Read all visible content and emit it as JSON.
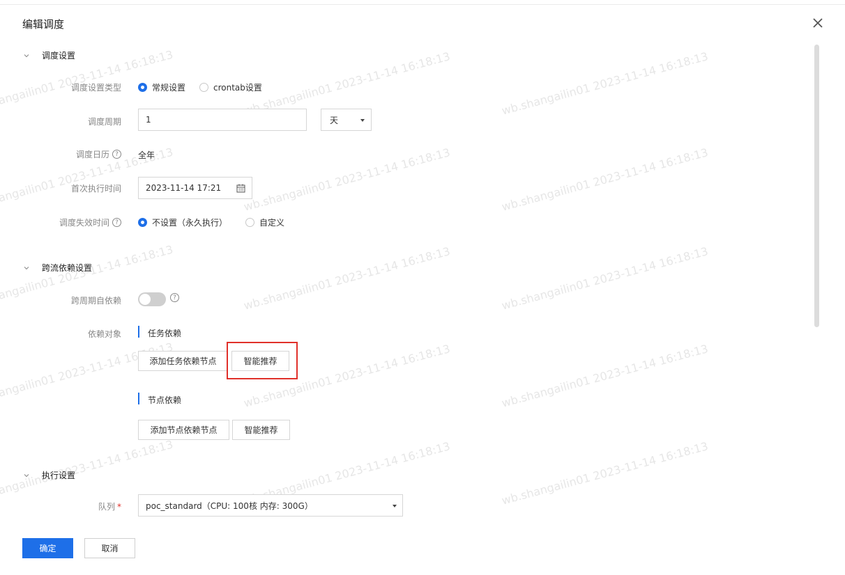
{
  "dialog": {
    "title": "编辑调度"
  },
  "watermark": {
    "text": "wb.shangailin01 2023-11-14 16:18:13",
    "left_fragment": "shangailin01 2023-11-14 16:18:13"
  },
  "schedule": {
    "section_title": "调度设置",
    "type_label": "调度设置类型",
    "type_options": [
      "常规设置",
      "crontab设置"
    ],
    "period_label": "调度周期",
    "period_value": "1",
    "period_unit": "天",
    "calendar_label": "调度日历",
    "calendar_value": "全年",
    "first_run_label": "首次执行时间",
    "first_run_value": "2023-11-14 17:21",
    "expire_label": "调度失效时间",
    "expire_options": [
      "不设置（永久执行）",
      "自定义"
    ]
  },
  "dependency": {
    "section_title": "跨流依赖设置",
    "self_dep_label": "跨周期自依赖",
    "object_label": "依赖对象",
    "task_dep_title": "任务依赖",
    "add_task_button": "添加任务依赖节点",
    "smart_button_1": "智能推荐",
    "node_dep_title": "节点依赖",
    "add_node_button": "添加节点依赖节点",
    "smart_button_2": "智能推荐"
  },
  "execution": {
    "section_title": "执行设置",
    "queue_label": "队列",
    "queue_required": "*",
    "queue_value": "poc_standard（CPU: 100核 内存: 300G）"
  },
  "footer": {
    "confirm": "确定",
    "cancel": "取消"
  },
  "colors": {
    "primary": "#1e6fe8",
    "highlight": "#e0302a"
  }
}
